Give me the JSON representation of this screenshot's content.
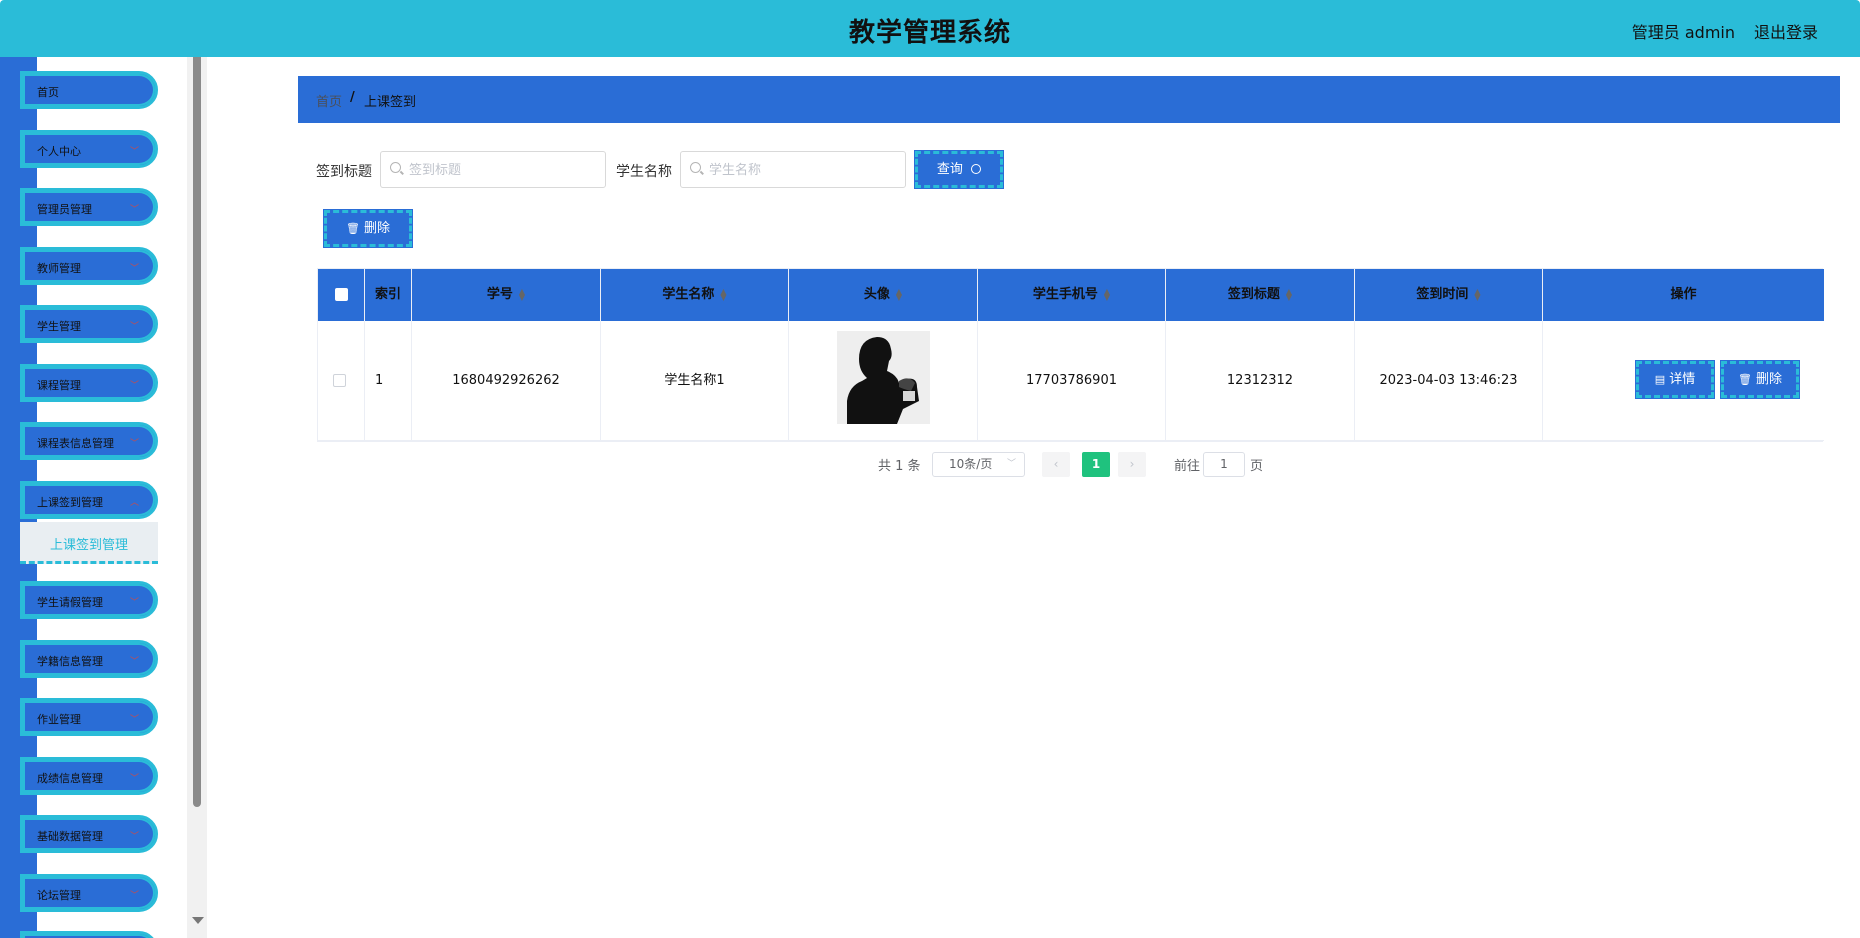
{
  "header": {
    "title": "教学管理系统",
    "user": "管理员 admin",
    "logout": "退出登录"
  },
  "sidebar": {
    "items": [
      {
        "label": "首页"
      },
      {
        "label": "个人中心"
      },
      {
        "label": "管理员管理"
      },
      {
        "label": "教师管理"
      },
      {
        "label": "学生管理"
      },
      {
        "label": "课程管理"
      },
      {
        "label": "课程表信息管理"
      },
      {
        "label": "上课签到管理"
      },
      {
        "label": "学生请假管理"
      },
      {
        "label": "学籍信息管理"
      },
      {
        "label": "作业管理"
      },
      {
        "label": "成绩信息管理"
      },
      {
        "label": "基础数据管理"
      },
      {
        "label": "论坛管理"
      }
    ],
    "active_sub": "上课签到管理"
  },
  "breadcrumb": {
    "home": "首页",
    "separator": "/",
    "current": "上课签到"
  },
  "search": {
    "title_label": "签到标题",
    "title_placeholder": "签到标题",
    "student_label": "学生名称",
    "student_placeholder": "学生名称",
    "query_button": "查询",
    "delete_button": "删除"
  },
  "table": {
    "columns": [
      "索引",
      "学号",
      "学生名称",
      "头像",
      "学生手机号",
      "签到标题",
      "签到时间",
      "操作"
    ],
    "rows": [
      {
        "index": "1",
        "student_no": "1680492926262",
        "student_name": "学生名称1",
        "phone": "17703786901",
        "sign_title": "12312312",
        "sign_time": "2023-04-03 13:46:23",
        "detail_button": "详情",
        "delete_button": "删除"
      }
    ]
  },
  "pagination": {
    "total": "共 1 条",
    "page_size": "10条/页",
    "current_page": "1",
    "goto_label": "前往",
    "goto_value": "1",
    "goto_unit": "页"
  },
  "colors": {
    "header_bg": "#2abcd8",
    "primary_blue": "#2a6dd6",
    "active_page": "#1fc27e"
  }
}
